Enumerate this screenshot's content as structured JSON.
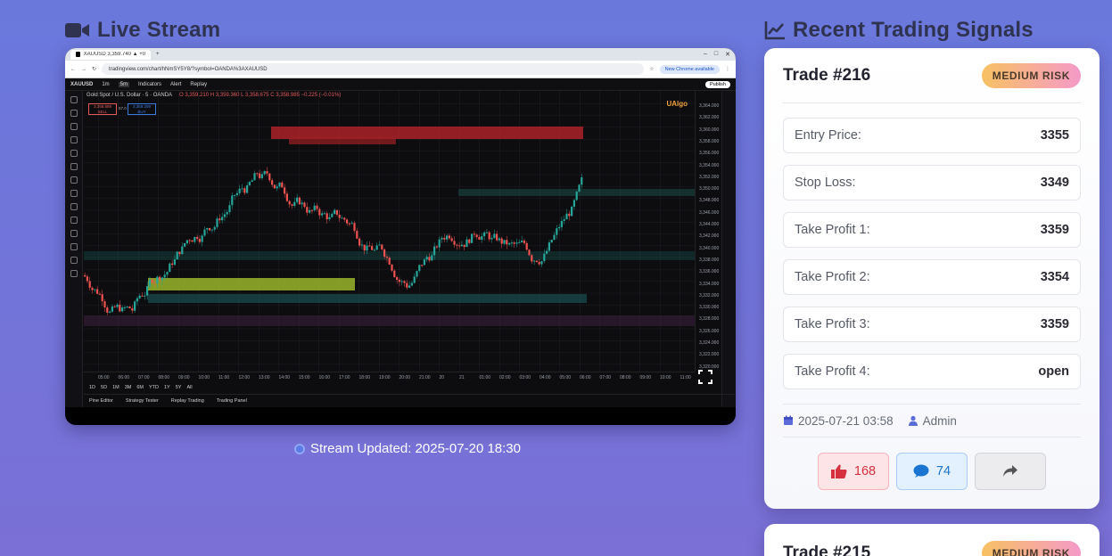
{
  "live_stream": {
    "title": "Live Stream",
    "stream_updated": "Stream Updated: 2025-07-20 18:30",
    "screenshot": {
      "browser_tab": "XAUUSD 3,359.740 ▲ +0.29% ...",
      "url": "tradingview.com/chart/hNmSY5Y8/?symbol=OANDA%3AXAUUSD",
      "chrome_notice": "New Chrome available",
      "symbol": "XAUUSD",
      "intervals": [
        "1m",
        "5m"
      ],
      "toolbar_items": [
        "Indicators",
        "Alert",
        "Replay"
      ],
      "publish": "Publish",
      "chart_title": "Gold Spot / U.S. Dollar · 5 · OANDA",
      "ohlc": "O 3,359.210 H 3,359.360 L 3,358.675 C 3,358.985 −0.225 (−0.01%)",
      "sell_price": "3,358.689",
      "sell_label": "SELL",
      "spread": "57.0",
      "buy_price": "3,359.259",
      "buy_label": "BUY",
      "indicator": "UAlgo",
      "price_ticks": [
        "3,364.000",
        "3,362.000",
        "3,360.000",
        "3,358.000",
        "3,356.000",
        "3,354.000",
        "3,352.000",
        "3,350.000",
        "3,348.000",
        "3,346.000",
        "3,344.000",
        "3,342.000",
        "3,340.000",
        "3,338.000",
        "3,336.000",
        "3,334.000",
        "3,332.000",
        "3,330.000",
        "3,328.000",
        "3,326.000",
        "3,324.000",
        "3,322.000",
        "3,320.000"
      ],
      "time_ticks": [
        "05:00",
        "06:00",
        "07:00",
        "08:00",
        "09:00",
        "10:00",
        "11:00",
        "12:00",
        "13:00",
        "14:00",
        "15:00",
        "16:00",
        "17:00",
        "18:00",
        "19:00",
        "20:00",
        "21:00",
        "20",
        "21",
        "01:00",
        "02:00",
        "03:00",
        "04:00",
        "05:00",
        "06:00",
        "07:00",
        "08:00",
        "09:00",
        "10:00",
        "11:00"
      ],
      "ranges": [
        "1D",
        "5D",
        "1M",
        "3M",
        "6M",
        "YTD",
        "1Y",
        "5Y",
        "All"
      ],
      "bottom_tabs": [
        "Pine Editor",
        "Strategy Tester",
        "Replay Trading",
        "Trading Panel"
      ]
    }
  },
  "signals": {
    "title": "Recent Trading Signals",
    "trades": [
      {
        "title": "Trade #216",
        "risk": "MEDIUM RISK",
        "rows": [
          {
            "label": "Entry Price:",
            "value": "3355"
          },
          {
            "label": "Stop Loss:",
            "value": "3349"
          },
          {
            "label": "Take Profit 1:",
            "value": "3359"
          },
          {
            "label": "Take Profit 2:",
            "value": "3354"
          },
          {
            "label": "Take Profit 3:",
            "value": "3359"
          },
          {
            "label": "Take Profit 4:",
            "value": "open"
          }
        ],
        "date": "2025-07-21 03:58",
        "author": "Admin",
        "likes": "168",
        "comments": "74"
      },
      {
        "title": "Trade #215",
        "risk": "MEDIUM RISK"
      }
    ]
  },
  "colors": {
    "background": "#6f75da",
    "bull": "#26a69a",
    "bear": "#ef5350",
    "badge_gradient_start": "#f7c163",
    "badge_gradient_end": "#f59ac8"
  }
}
